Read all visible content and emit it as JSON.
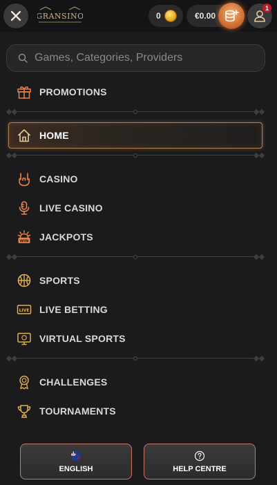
{
  "header": {
    "logo_text": "GRANSINO",
    "coins": "0",
    "balance": "€0.00",
    "notification_count": "1"
  },
  "search": {
    "placeholder": "Games, Categories, Providers"
  },
  "menu": {
    "promotions": "PROMOTIONS",
    "home": "HOME",
    "casino": "CASINO",
    "live_casino": "LIVE CASINO",
    "jackpots": "JACKPOTS",
    "sports": "SPORTS",
    "live_betting": "LIVE BETTING",
    "virtual_sports": "VIRTUAL SPORTS",
    "challenges": "CHALLENGES",
    "tournaments": "TOURNAMENTS"
  },
  "icons": {
    "win_badge": "WIN",
    "live_badge": "LIVE"
  },
  "footer": {
    "language": "ENGLISH",
    "help": "HELP CENTRE"
  },
  "colors": {
    "accent": "#e8834a",
    "icon_gold": "#e0b050",
    "background": "#1b1b1d"
  }
}
